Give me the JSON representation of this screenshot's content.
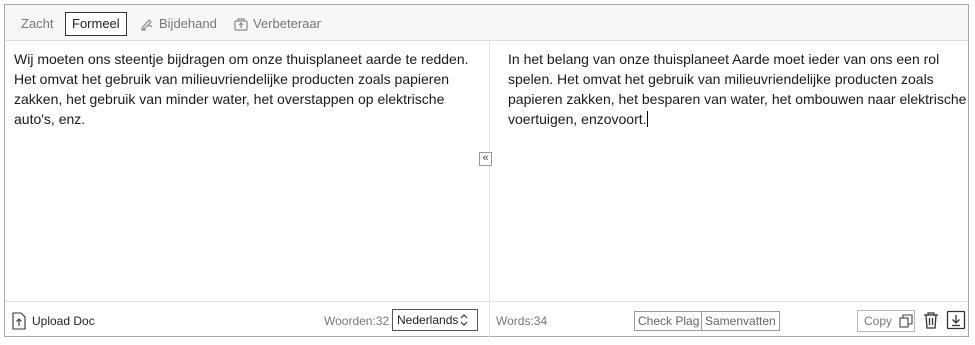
{
  "modes": [
    {
      "label": "Zacht",
      "active": false,
      "icon": null
    },
    {
      "label": "Formeel",
      "active": true,
      "icon": null
    },
    {
      "label": "Bijdehand",
      "active": false,
      "icon": "writing-hand-icon"
    },
    {
      "label": "Verbeteraar",
      "active": false,
      "icon": "upgrade-icon"
    }
  ],
  "input": {
    "text": "Wij moeten ons steentje bijdragen om onze thuisplaneet aarde te redden. Het omvat het gebruik van milieuvriendelijke producten zoals papieren zakken, het gebruik van minder water, het overstappen op elektrische auto's, enz."
  },
  "output": {
    "text": "In het belang van onze thuisplaneet Aarde moet ieder van ons een rol spelen. Het omvat het gebruik van milieuvriendelijke producten zoals papieren zakken, het besparen van water, het ombouwen naar elektrische voertuigen, enzovoort."
  },
  "swap": {
    "glyph": "«",
    "icon": "double-chevron-left-icon"
  },
  "footer_left": {
    "upload_label": "Upload Doc",
    "word_count": "Woorden:32",
    "language": "Nederlands"
  },
  "footer_right": {
    "word_count": "Words:34",
    "check_plag": "Check Plag",
    "summarize": "Samenvatten",
    "copy": "Copy"
  },
  "colors": {
    "accent_border": "#333333",
    "muted_text": "#777777"
  }
}
